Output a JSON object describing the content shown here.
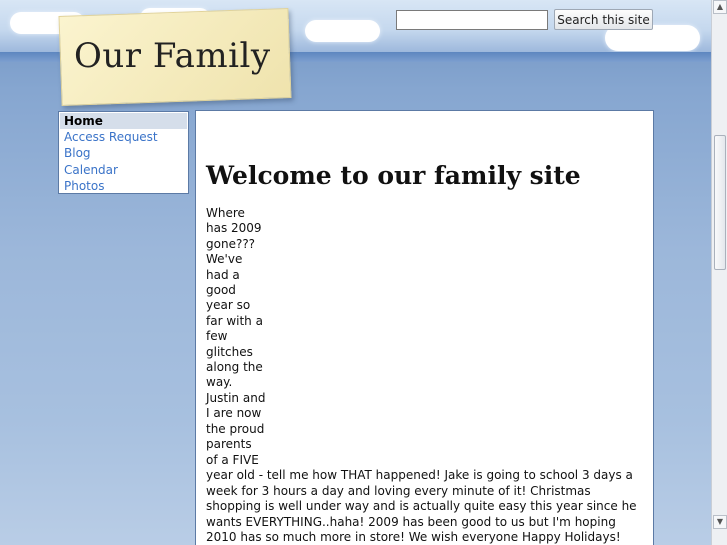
{
  "header": {
    "site_title": "Our Family"
  },
  "search": {
    "value": "",
    "placeholder": "",
    "button_label": "Search this site"
  },
  "nav": {
    "items": [
      {
        "label": "Home",
        "active": true
      },
      {
        "label": "Access Request",
        "active": false
      },
      {
        "label": "Blog",
        "active": false
      },
      {
        "label": "Calendar",
        "active": false
      },
      {
        "label": "Photos",
        "active": false
      }
    ]
  },
  "content": {
    "title": "Welcome to our family site",
    "intro_narrow": "Where has 2009 gone??? We've had a good year so far with a few glitches along the way. Justin and I are now the proud parents of a FIVE",
    "intro_wide": "year old - tell me how THAT happened!  Jake is going to school 3 days a week for 3 hours a day and loving every minute of it!  Christmas shopping is well under way and is actually quite easy this year since he wants EVERYTHING..haha!  2009 has been good to us but I'm hoping 2010 has so much more in store!  We wish everyone Happy Holidays!"
  },
  "colors": {
    "link": "#3a73c8",
    "note": "#fbf4cf",
    "sky": "#86a6d0"
  }
}
